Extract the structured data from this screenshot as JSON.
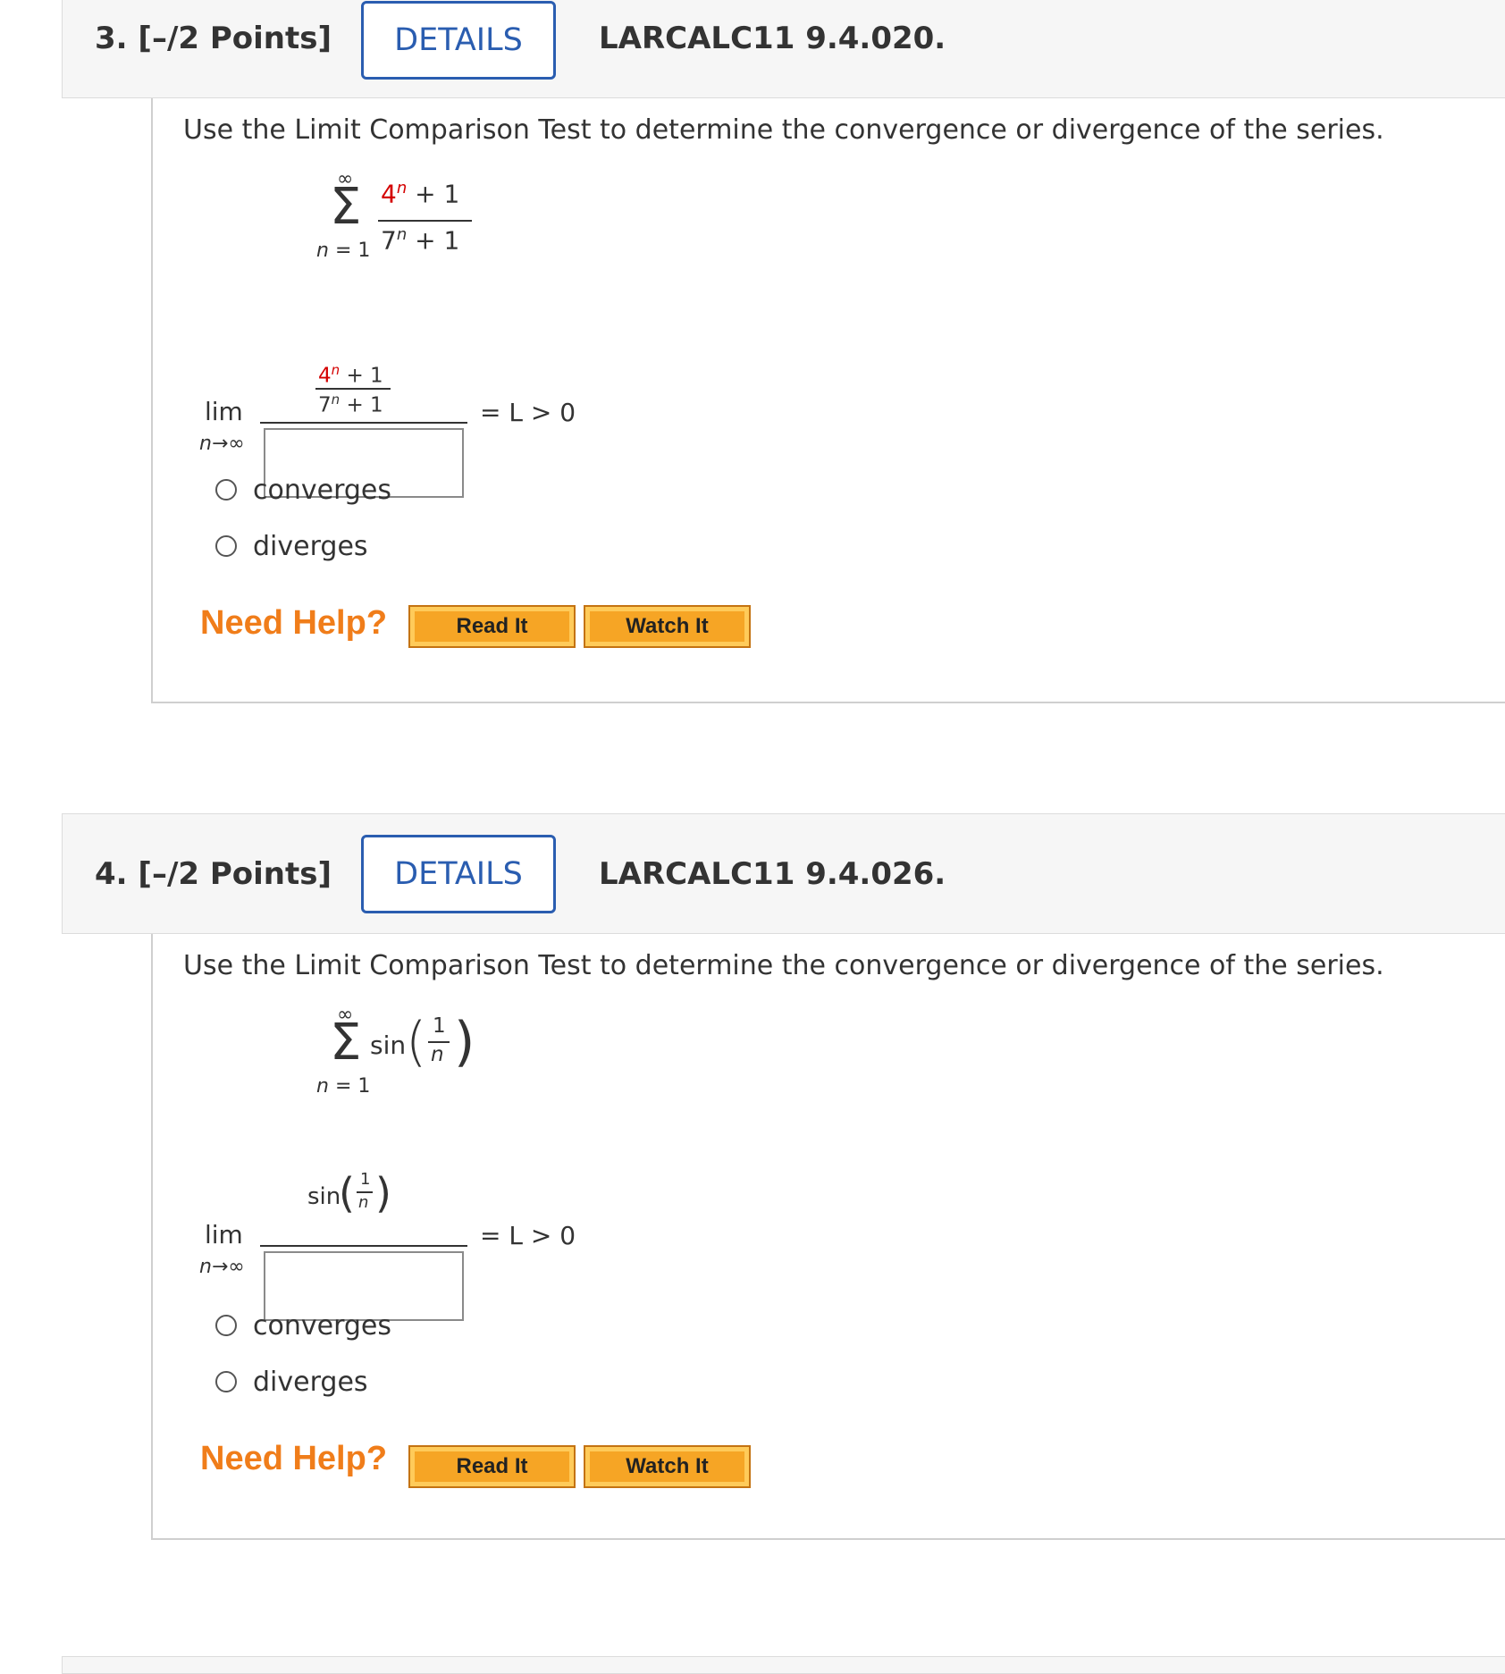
{
  "questions": [
    {
      "number": "3.",
      "points": "[–/2 Points]",
      "details_label": "DETAILS",
      "code": "LARCALC11 9.4.020.",
      "prompt": "Use the Limit Comparison Test to determine the convergence or divergence of the series.",
      "series": {
        "upper": "∞",
        "lower": "n = 1",
        "numerator_base": "4",
        "numerator_exp": "n",
        "numerator_rest": " + 1",
        "denominator_base": "7",
        "denominator_exp": "n",
        "denominator_rest": " + 1"
      },
      "limit": {
        "lim": "lim",
        "sub": "n→∞",
        "rhs": "= L > 0"
      },
      "options": [
        "converges",
        "diverges"
      ],
      "need_help": "Need Help?",
      "read_it": "Read It",
      "watch_it": "Watch It"
    },
    {
      "number": "4.",
      "points": "[–/2 Points]",
      "details_label": "DETAILS",
      "code": "LARCALC11 9.4.026.",
      "prompt": "Use the Limit Comparison Test to determine the convergence or divergence of the series.",
      "series": {
        "upper": "∞",
        "lower": "n = 1",
        "func": "sin",
        "frac_num": "1",
        "frac_den": "n"
      },
      "limit": {
        "lim": "lim",
        "sub": "n→∞",
        "rhs": "= L > 0"
      },
      "options": [
        "converges",
        "diverges"
      ],
      "need_help": "Need Help?",
      "read_it": "Read It",
      "watch_it": "Watch It"
    }
  ],
  "colors": {
    "details_blue": "#2a5db0",
    "need_help_orange": "#f07d1a",
    "button_orange": "#f6a525",
    "highlight_red": "#d40000"
  }
}
